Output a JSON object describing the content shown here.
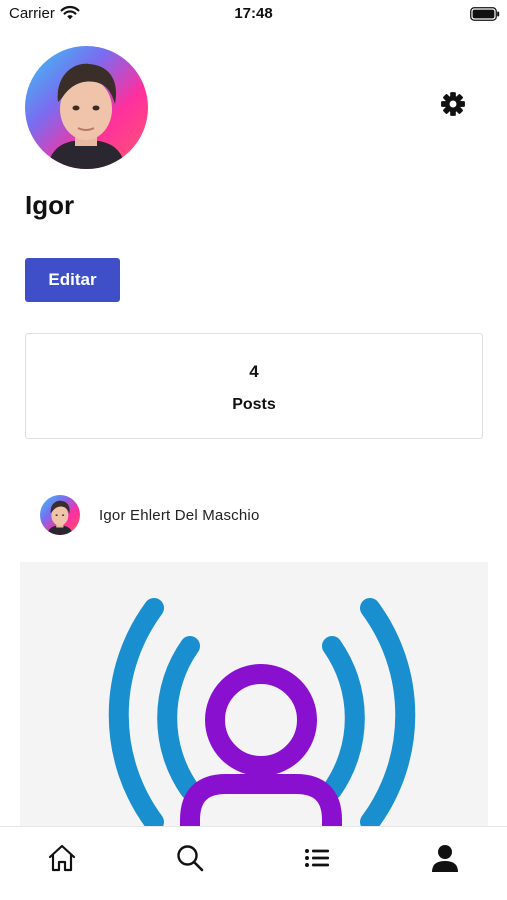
{
  "status_bar": {
    "carrier": "Carrier",
    "time": "17:48",
    "icons": [
      "wifi-icon",
      "battery-icon"
    ]
  },
  "profile": {
    "name": "Igor",
    "edit_label": "Editar",
    "settings_icon": "gear-icon"
  },
  "stats": {
    "posts_count": "4",
    "posts_label": "Posts"
  },
  "post": {
    "author": "Igor Ehlert Del Maschio",
    "image_icon": "broadcasting-person-icon"
  },
  "tab_bar": {
    "tabs": [
      {
        "icon": "home-icon",
        "active": false
      },
      {
        "icon": "search-icon",
        "active": false
      },
      {
        "icon": "list-icon",
        "active": false
      },
      {
        "icon": "user-icon",
        "active": true
      }
    ]
  },
  "colors": {
    "accent": "#3f4fc7",
    "signal_blue": "#1a8fcf",
    "person_purple": "#8a10cf",
    "avatar_gradient": [
      "#ff2f7d",
      "#35c9f2"
    ]
  }
}
